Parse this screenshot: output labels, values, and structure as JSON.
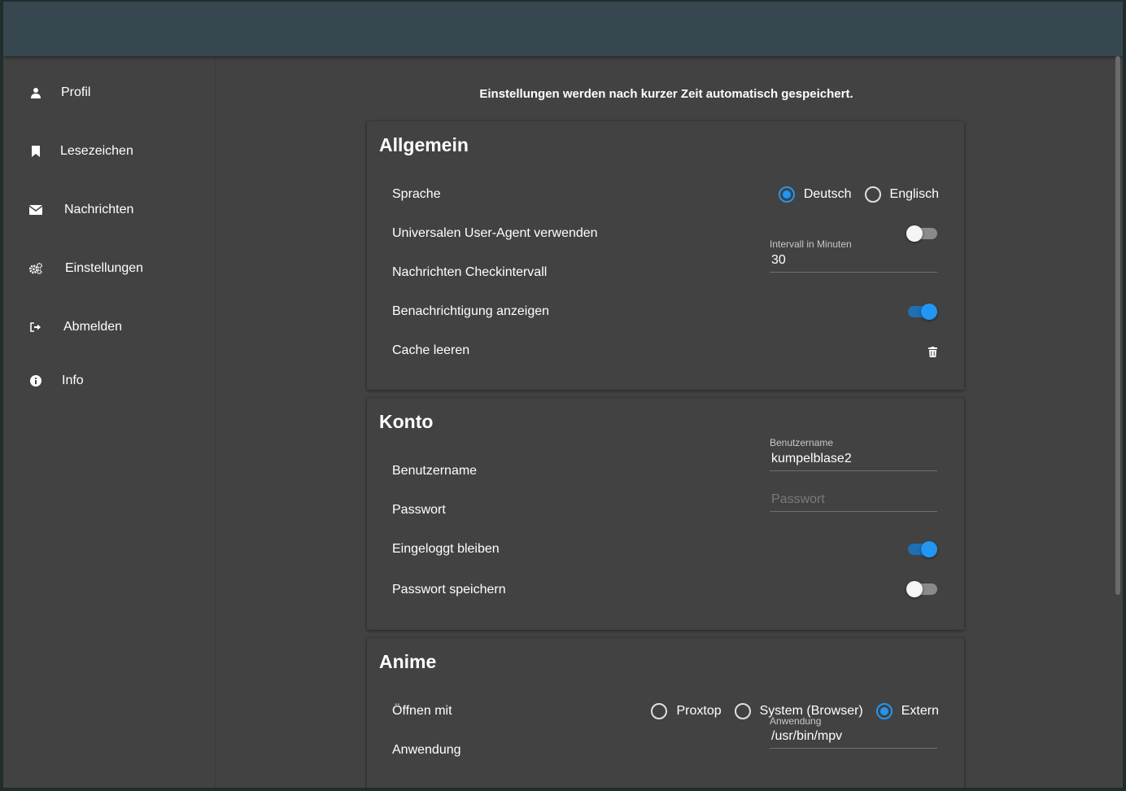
{
  "sidebar": {
    "items": [
      {
        "label": "Profil",
        "icon": "user-icon"
      },
      {
        "label": "Lesezeichen",
        "icon": "bookmark-icon"
      },
      {
        "label": "Nachrichten",
        "icon": "envelope-icon"
      },
      {
        "label": "Einstellungen",
        "icon": "gears-icon"
      },
      {
        "label": "Abmelden",
        "icon": "sign-out-icon"
      },
      {
        "label": "Info",
        "icon": "info-icon"
      }
    ]
  },
  "main": {
    "notice": "Einstellungen werden nach kurzer Zeit automatisch gespeichert."
  },
  "general": {
    "title": "Allgemein",
    "language_label": "Sprache",
    "language_options": [
      "Deutsch",
      "Englisch"
    ],
    "language_selected": "Deutsch",
    "user_agent_label": "Universalen User-Agent verwenden",
    "user_agent_enabled": false,
    "check_interval_label": "Nachrichten Checkintervall",
    "interval_field_label": "Intervall in Minuten",
    "interval_value": "30",
    "notification_label": "Benachrichtigung anzeigen",
    "notification_enabled": true,
    "cache_label": "Cache leeren"
  },
  "account": {
    "title": "Konto",
    "username_label": "Benutzername",
    "username_field_label": "Benutzername",
    "username_value": "kumpelblase2",
    "password_label": "Passwort",
    "password_placeholder": "Passwort",
    "stay_logged_in_label": "Eingeloggt bleiben",
    "stay_logged_in_enabled": true,
    "save_password_label": "Passwort speichern",
    "save_password_enabled": false
  },
  "anime": {
    "title": "Anime",
    "open_with_label": "Öffnen mit",
    "open_with_options": [
      "Proxtop",
      "System (Browser)",
      "Extern"
    ],
    "open_with_selected": "Extern",
    "application_label": "Anwendung",
    "application_field_label": "Anwendung",
    "application_value": "/usr/bin/mpv"
  },
  "colors": {
    "accent": "#2196f3",
    "topbar": "#37474f",
    "background": "#424242"
  }
}
